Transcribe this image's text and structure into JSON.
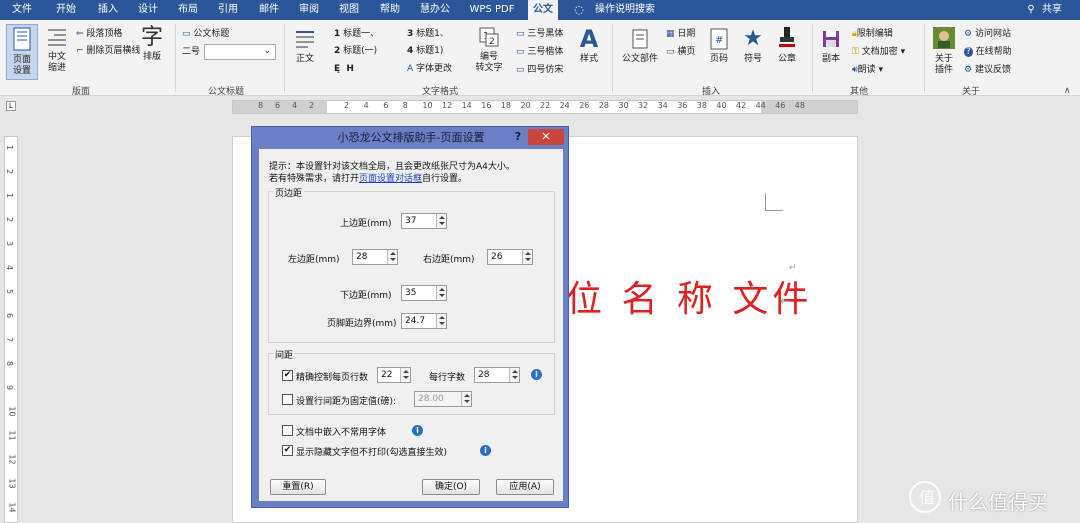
{
  "menubar": {
    "tabs": [
      "文件",
      "开始",
      "插入",
      "设计",
      "布局",
      "引用",
      "邮件",
      "审阅",
      "视图",
      "帮助",
      "慧办公",
      "WPS PDF",
      "公文",
      "操作说明搜索"
    ],
    "active_tab": "公文",
    "share_label": "共享"
  },
  "ribbon": {
    "groups": {
      "layout": {
        "label": "版面",
        "page_setup": "页面\n设置",
        "chinese_indent": "中文\n缩进",
        "paragraph_top": "段落顶格",
        "remove_header_line": "删除页眉横线",
        "typeset": "排版"
      },
      "doc_title": {
        "label": "公文标题",
        "title_item": "公文标题",
        "size_label": "二号"
      },
      "text_format": {
        "label": "文字格式",
        "body": "正文",
        "h1": "标题一、",
        "h2": "标题(一)",
        "h3": "标题1、",
        "h4": "标题1)",
        "font_change": "字体更改",
        "num_to_text": "编号\n转文字",
        "font1": "三号黑体",
        "font2": "三号楷体",
        "font3": "四号仿宋",
        "style": "样式"
      },
      "insert": {
        "label": "插入",
        "doc_part": "公文部件",
        "date": "日期",
        "landscape": "横页",
        "page_num": "页码",
        "symbol": "符号",
        "seal": "公章"
      },
      "other": {
        "label": "其他",
        "copy": "副本",
        "restrict_edit": "限制编辑",
        "doc_encrypt": "文档加密",
        "read": "朗读"
      },
      "about": {
        "label": "关于",
        "about_plugin": "关于\n插件",
        "visit_site": "访问网站",
        "online_help": "在线帮助",
        "feedback": "建议反馈"
      }
    }
  },
  "ruler": {
    "numbers": [
      "8",
      "6",
      "4",
      "2",
      "2",
      "4",
      "6",
      "8",
      "10",
      "12",
      "14",
      "16",
      "18",
      "20",
      "22",
      "24",
      "26",
      "28",
      "30",
      "32",
      "34",
      "36",
      "38",
      "40",
      "42",
      "44",
      "46",
      "48"
    ],
    "vertical": [
      "1",
      "2",
      "1",
      "2",
      "3",
      "4",
      "5",
      "6",
      "7",
      "8",
      "9",
      "10",
      "11",
      "12",
      "13",
      "14"
    ]
  },
  "document": {
    "title_text": "位 名 称 文件",
    "colors": {
      "title": "#e02020"
    }
  },
  "dialog": {
    "title": "小恐龙公文排版助手-页面设置",
    "help_glyph": "?",
    "close_glyph": "✕",
    "hint_line1": "提示：本设置针对该文档全局，且会更改纸张尺寸为A4大小。",
    "hint_line2_prefix": "若有特殊需求，请打开",
    "hint_link": "页面设置对话框",
    "hint_line2_suffix": "自行设置。",
    "margins_group": "页边距",
    "top_label": "上边距(mm)",
    "top_value": "37",
    "left_label": "左边距(mm)",
    "left_value": "28",
    "right_label": "右边距(mm)",
    "right_value": "26",
    "bottom_label": "下边距(mm)",
    "bottom_value": "35",
    "footer_label": "页脚距边界(mm)",
    "footer_value": "24.7",
    "spacing_group": "间距",
    "precise_lines_label": "精确控制每页行数",
    "precise_lines_checked": true,
    "lines_value": "22",
    "chars_label": "每行字数",
    "chars_value": "28",
    "fixed_spacing_label": "设置行间距为固定值(磅):",
    "fixed_spacing_checked": false,
    "fixed_spacing_value": "28.00",
    "embed_fonts_label": "文档中嵌入不常用字体",
    "embed_fonts_checked": false,
    "show_hidden_label": "显示隐藏文字但不打印(勾选直接生效)",
    "show_hidden_checked": true,
    "reset_button": "重置(R)",
    "ok_button": "确定(O)",
    "apply_button": "应用(A)",
    "info_glyph": "i"
  },
  "watermark": {
    "text": "什么值得买"
  }
}
